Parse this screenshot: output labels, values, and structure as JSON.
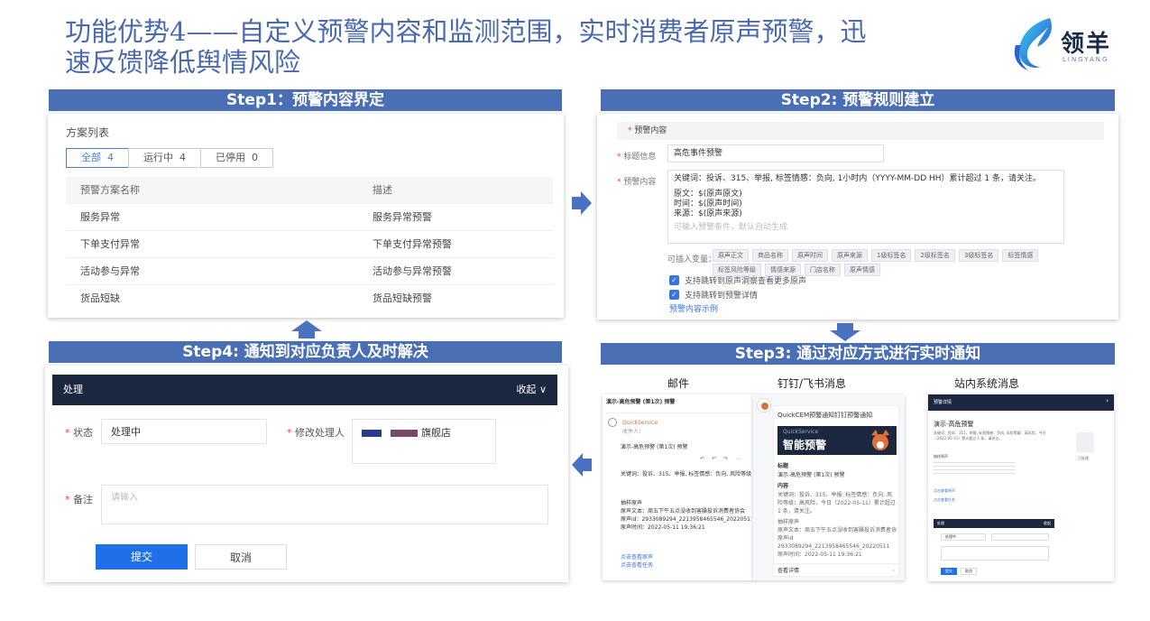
{
  "title": "功能优势4——自定义预警内容和监测范围，实时消费者原声预警，迅速反馈降低舆情风险",
  "logo": {
    "name": "领羊",
    "sub": "LINGYANG"
  },
  "step1": {
    "label": "Step1：预警内容界定",
    "heading": "方案列表",
    "tabs": [
      {
        "label": "全部",
        "count": "4"
      },
      {
        "label": "运行中",
        "count": "4"
      },
      {
        "label": "已停用",
        "count": "0"
      }
    ],
    "columns": [
      "预警方案名称",
      "描述"
    ],
    "rows": [
      [
        "服务异常",
        "服务异常预警"
      ],
      [
        "下单支付异常",
        "下单支付异常预警"
      ],
      [
        "活动参与异常",
        "活动参与异常预警"
      ],
      [
        "货品短缺",
        "货品短缺预警"
      ]
    ]
  },
  "step2": {
    "label": "Step2: 预警规则建立",
    "section": "预警内容",
    "title_label": "标题信息",
    "title_value": "高危事件预警",
    "content_label": "预警内容",
    "content_line1": "关键词：投诉、315、举报, 标签情感：负向, 1小时内（YYYY-MM-DD HH）累计超过 1 条，请关注。",
    "content_line2": "原文：$(原声原文)",
    "content_line3": "时间：$(原声时间)",
    "content_line4": "来源：$(原声来源)",
    "content_placeholder": "可输入预警条件，默认自动生成",
    "vars_label": "可插入变量：",
    "tags": [
      "原声正文",
      "商品名称",
      "原声时间",
      "原声来源",
      "1级标签名",
      "2级标签名",
      "3级标签名",
      "标签情感",
      "标签风险等级",
      "情感来源",
      "门店名称",
      "原声情感"
    ],
    "check1": "支持跳转到原声洞察查看更多原声",
    "check2": "支持跳转到预警详情",
    "link": "预警内容示例"
  },
  "step3": {
    "label": "Step3: 通过对应方式进行实时通知",
    "ch_mail": "邮件",
    "ch_dingtalk": "钉钉/飞书消息",
    "ch_site": "站内系统消息",
    "mail": {
      "subject": "演示-高危预警 (第1次) 预警",
      "sender": "QuickService",
      "recipient": "收件人：",
      "body_title": "演示-高危预警 (第1次) 预警",
      "keywords": "关键词：投诉、315、举报, 标签情感：负向, 风险等级：高风险, 今日",
      "sample_title": "抽样原声",
      "sample_text": "原声文本：周五下午五点没收到害臊投诉消费者协会",
      "sample_id": "原声id：2933089294_2213958465546_20220511",
      "sample_time": "原声时间：2022-05-11 19:36:21",
      "link1": "点击查看原声",
      "link2": "点击查看任务"
    },
    "ding": {
      "app": "QuickCEM预警通知钉钉预警通知",
      "banner_sub": "QuickService",
      "banner_title": "智能预警",
      "h_title": "标题",
      "title_value": "演示-高危预警 (第1次) 预警",
      "h_content": "内容",
      "content_value": "关键词：投诉、315、举报, 标签情感：负向, 风险等级：高风险，今日（2022-05-11）累计超过 1 条，请关注。",
      "sample_title": "抽样原声",
      "sample_text": "原声文本：周五下午五点没收到害臊投诉消费者协会",
      "sample_id_label": "原声id",
      "sample_id": "2933089294_2213958465546_20220511",
      "sample_time": "原声时间：2022-05-11 19:36:21",
      "detail": "查看详情"
    },
    "site": {
      "header": "预警详情",
      "title": "演示-高危预警",
      "desc": "关键词：投诉、315、举报, 标签情感：负向, 风险等级：高风险，今日（2022-05-11）累计超过 1 条，请关注。",
      "sample_title": "抽样原声",
      "link1": "点击查看原声",
      "link2": "点击查看任务",
      "status": "已处理",
      "form_header": "处理",
      "form_collapse": "收起",
      "form_status": "处理中",
      "submit": "提交",
      "cancel": "取消"
    }
  },
  "step4": {
    "label": "Step4: 通知到对应负责人及时解决",
    "header": "处理",
    "collapse": "收起",
    "status_label": "状态",
    "status_value": "处理中",
    "handler_label": "修改处理人",
    "handler_value": "旗舰店",
    "remark_label": "备注",
    "remark_placeholder": "请输入",
    "submit": "提交",
    "cancel": "取消"
  },
  "colors": {
    "step_bar": "#4a6fb5",
    "title": "#4a6ab0",
    "primary": "#1f6fe8",
    "dark_header": "#1c2840"
  }
}
